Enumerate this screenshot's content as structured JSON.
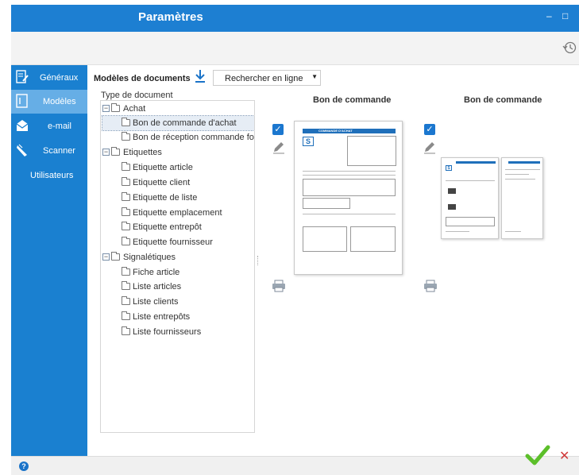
{
  "window": {
    "title": "Paramètres",
    "minimize_icon": "minimize-icon",
    "maximize_icon": "maximize-icon"
  },
  "toolbar": {
    "history_icon": "history-icon"
  },
  "sidebar": {
    "items": [
      {
        "label": "Généraux",
        "icon": "edit-document-icon",
        "active": false
      },
      {
        "label": "Modèles",
        "icon": "template-icon",
        "active": true
      },
      {
        "label": "e-mail",
        "icon": "envelope-icon",
        "active": false
      },
      {
        "label": "Scanner",
        "icon": "scanner-icon",
        "active": false
      },
      {
        "label": "Utilisateurs",
        "icon": "",
        "active": false
      }
    ]
  },
  "content": {
    "header_label": "Modèles de documents",
    "download_icon": "download-icon",
    "search_select": {
      "value": "Rechercher en ligne"
    },
    "tree_label": "Type de document",
    "tree": [
      {
        "label": "Achat",
        "expanded": true,
        "children": [
          {
            "label": "Bon de commande d'achat",
            "selected": true
          },
          {
            "label": "Bon de réception commande fou",
            "selected": false
          }
        ]
      },
      {
        "label": "Etiquettes",
        "expanded": true,
        "children": [
          {
            "label": "Etiquette article"
          },
          {
            "label": "Etiquette client"
          },
          {
            "label": "Etiquette de liste"
          },
          {
            "label": "Etiquette emplacement"
          },
          {
            "label": "Etiquette entrepôt"
          },
          {
            "label": "Etiquette fournisseur"
          }
        ]
      },
      {
        "label": "Signalétiques",
        "expanded": true,
        "children": [
          {
            "label": "Fiche article"
          },
          {
            "label": "Liste articles"
          },
          {
            "label": "Liste clients"
          },
          {
            "label": "Liste entrepôts"
          },
          {
            "label": "Liste fournisseurs"
          }
        ]
      }
    ],
    "previews": [
      {
        "title": "Bon de commande",
        "checked": true,
        "page_heading": "COMMANDE D'ACHAT",
        "logo": "S"
      },
      {
        "title": "Bon de commande",
        "checked": true,
        "logo": "S"
      }
    ]
  },
  "footer": {
    "help": "?"
  },
  "colors": {
    "accent": "#1d7fd2",
    "sidebar_active": "#66aee6",
    "ok": "#5cbf2a",
    "cancel": "#d03a3a"
  }
}
